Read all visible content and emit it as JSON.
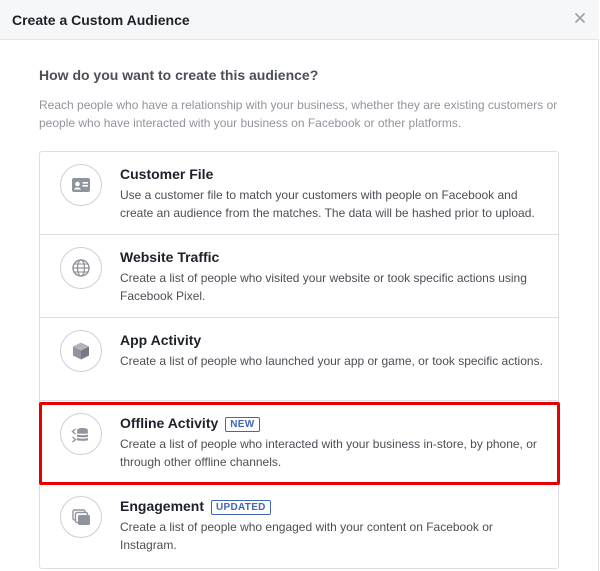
{
  "dialog": {
    "title": "Create a Custom Audience",
    "close_icon": "close-icon"
  },
  "main": {
    "question": "How do you want to create this audience?",
    "description": "Reach people who have a relationship with your business, whether they are existing customers or people who have interacted with your business on Facebook or other platforms."
  },
  "options": [
    {
      "title": "Customer File",
      "badge": "",
      "description": "Use a customer file to match your customers with people on Facebook and create an audience from the matches. The data will be hashed prior to upload.",
      "icon": "contact-card-icon"
    },
    {
      "title": "Website Traffic",
      "badge": "",
      "description": "Create a list of people who visited your website or took specific actions using Facebook Pixel.",
      "icon": "globe-icon"
    },
    {
      "title": "App Activity",
      "badge": "",
      "description": "Create a list of people who launched your app or game, or took specific actions.",
      "icon": "cube-icon"
    },
    {
      "title": "Offline Activity",
      "badge": "NEW",
      "description": "Create a list of people who interacted with your business in-store, by phone, or through other offline channels.",
      "icon": "database-arrows-icon"
    },
    {
      "title": "Engagement",
      "badge": "UPDATED",
      "description": "Create a list of people who engaged with your content on Facebook or Instagram.",
      "icon": "stacked-cards-icon"
    }
  ],
  "colors": {
    "highlight": "#e60000",
    "badge": "#4267b2",
    "icon": "#90949c"
  }
}
